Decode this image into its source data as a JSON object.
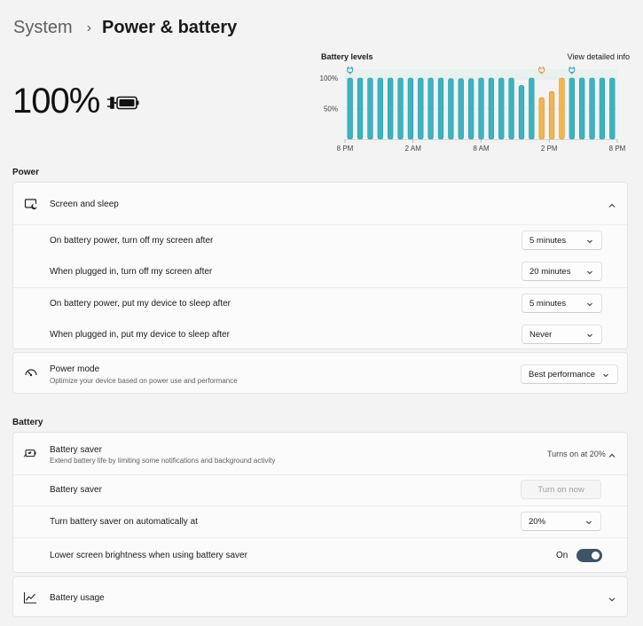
{
  "header": {
    "parent": "System",
    "separator": "›",
    "current": "Power & battery"
  },
  "battery_level": "100%",
  "chart": {
    "title": "Battery levels",
    "link": "View detailed info",
    "y_ticks": [
      "100%",
      "50%"
    ],
    "x_ticks": [
      "8 PM",
      "2 AM",
      "8 AM",
      "2 PM",
      "8 PM"
    ]
  },
  "chart_data": {
    "type": "bar",
    "title": "Battery levels",
    "ylim": [
      0,
      100
    ],
    "x_ticks": [
      "8 PM",
      "2 AM",
      "8 AM",
      "2 PM",
      "8 PM"
    ],
    "values": [
      100,
      100,
      100,
      100,
      100,
      100,
      100,
      100,
      100,
      100,
      99,
      99,
      99,
      100,
      100,
      100,
      100,
      88,
      100,
      68,
      78,
      100,
      100,
      100,
      100,
      100,
      100
    ],
    "charging": [
      false,
      false,
      false,
      false,
      false,
      false,
      false,
      false,
      false,
      false,
      false,
      false,
      false,
      false,
      false,
      false,
      false,
      false,
      false,
      true,
      true,
      true,
      false,
      false,
      false,
      false,
      false
    ],
    "colors": {
      "battery": "#3cb3c1",
      "charging": "#f0b550",
      "plugged_band": "#e8f1ee"
    }
  },
  "power": {
    "section_title": "Power",
    "screen_sleep": {
      "title": "Screen and sleep",
      "rows": [
        {
          "label": "On battery power, turn off my screen after",
          "value": "5 minutes"
        },
        {
          "label": "When plugged in, turn off my screen after",
          "value": "20 minutes"
        },
        {
          "label": "On battery power, put my device to sleep after",
          "value": "5 minutes"
        },
        {
          "label": "When plugged in, put my device to sleep after",
          "value": "Never"
        }
      ]
    },
    "power_mode": {
      "title": "Power mode",
      "subtitle": "Optimize your device based on power use and performance",
      "value": "Best performance"
    }
  },
  "battery": {
    "section_title": "Battery",
    "saver": {
      "title": "Battery saver",
      "subtitle": "Extend battery life by limiting some notifications and background activity",
      "status": "Turns on at 20%",
      "rows": {
        "saver_label": "Battery saver",
        "turn_on_button": "Turn on now",
        "auto_label": "Turn battery saver on automatically at",
        "auto_value": "20%",
        "brightness_label": "Lower screen brightness when using battery saver",
        "brightness_state": "On"
      }
    },
    "usage": {
      "title": "Battery usage"
    }
  },
  "accent": "#3d5566"
}
